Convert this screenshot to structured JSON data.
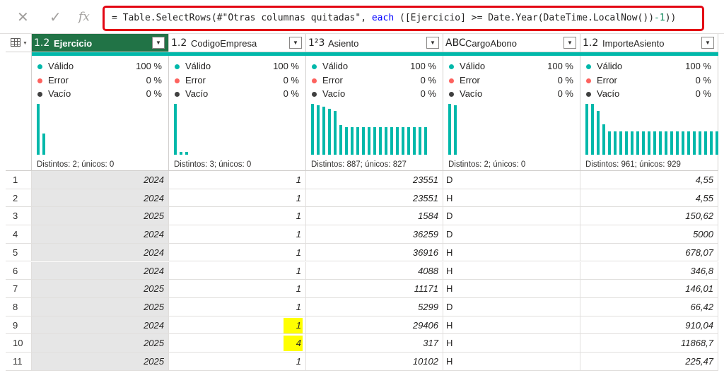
{
  "formula_bar": {
    "cancel_icon": "✕",
    "commit_icon": "✓",
    "fx_label": "fx",
    "formula_prefix": "= Table.SelectRows(#\"Otras columnas quitadas\", ",
    "formula_keyword": "each",
    "formula_middle": " ([Ejercicio] >= Date.Year(DateTime.LocalNow())",
    "formula_number": "-1",
    "formula_suffix": "))"
  },
  "profile_labels": {
    "valid": "Válido",
    "error": "Error",
    "empty": "Vacío"
  },
  "profile_colors": {
    "valid": "#01b8aa",
    "error": "#fd625e",
    "empty": "#404040",
    "accent": "#217346"
  },
  "columns": [
    {
      "type_icon": "1.2",
      "name": "Ejercicio",
      "valid": "100 %",
      "error": "0 %",
      "empty": "0 %",
      "distinct": "Distintos: 2; únicos: 0",
      "hist": [
        1.0,
        0.42
      ]
    },
    {
      "type_icon": "1.2",
      "name": "CodigoEmpresa",
      "valid": "100 %",
      "error": "0 %",
      "empty": "0 %",
      "distinct": "Distintos: 3; únicos: 0",
      "hist": [
        1.0,
        0.06,
        0.06
      ]
    },
    {
      "type_icon": "1²3",
      "name": "Asiento",
      "valid": "100 %",
      "error": "0 %",
      "empty": "0 %",
      "distinct": "Distintos: 887; únicos: 827",
      "hist": [
        1.0,
        0.97,
        0.94,
        0.9,
        0.86,
        0.58,
        0.54,
        0.54,
        0.54,
        0.54,
        0.54,
        0.54,
        0.54,
        0.54,
        0.54,
        0.54,
        0.54,
        0.54,
        0.54,
        0.54,
        0.54
      ]
    },
    {
      "type_icon": "ABC",
      "name": "CargoAbono",
      "valid": "100 %",
      "error": "0 %",
      "empty": "0 %",
      "distinct": "Distintos: 2; únicos: 0",
      "hist": [
        1.0,
        0.97
      ]
    },
    {
      "type_icon": "1.2",
      "name": "ImporteAsiento",
      "valid": "100 %",
      "error": "0 %",
      "empty": "0 %",
      "distinct": "Distintos: 961; únicos: 929",
      "hist": [
        1.0,
        1.0,
        0.86,
        0.6,
        0.46,
        0.46,
        0.46,
        0.46,
        0.46,
        0.46,
        0.46,
        0.46,
        0.46,
        0.46,
        0.46,
        0.46,
        0.46,
        0.46,
        0.46,
        0.46,
        0.46,
        0.46,
        0.46,
        0.46
      ]
    }
  ],
  "rows": [
    {
      "n": "1",
      "c": [
        "2024",
        "1",
        "23551",
        "D",
        "4,55"
      ]
    },
    {
      "n": "2",
      "c": [
        "2024",
        "1",
        "23551",
        "H",
        "4,55"
      ]
    },
    {
      "n": "3",
      "c": [
        "2025",
        "1",
        "1584",
        "D",
        "150,62"
      ]
    },
    {
      "n": "4",
      "c": [
        "2024",
        "1",
        "36259",
        "D",
        "5000"
      ]
    },
    {
      "n": "5",
      "c": [
        "2024",
        "1",
        "36916",
        "H",
        "678,07"
      ]
    },
    {
      "n": "6",
      "c": [
        "2024",
        "1",
        "4088",
        "H",
        "346,8"
      ]
    },
    {
      "n": "7",
      "c": [
        "2025",
        "1",
        "11171",
        "H",
        "146,01"
      ]
    },
    {
      "n": "8",
      "c": [
        "2025",
        "1",
        "5299",
        "D",
        "66,42"
      ]
    },
    {
      "n": "9",
      "c": [
        "2024",
        "1",
        "29406",
        "H",
        "910,04"
      ],
      "hl": true
    },
    {
      "n": "10",
      "c": [
        "2025",
        "4",
        "317",
        "H",
        "11868,7"
      ],
      "hl": true
    },
    {
      "n": "11",
      "c": [
        "2025",
        "1",
        "10102",
        "H",
        "225,47"
      ]
    }
  ]
}
